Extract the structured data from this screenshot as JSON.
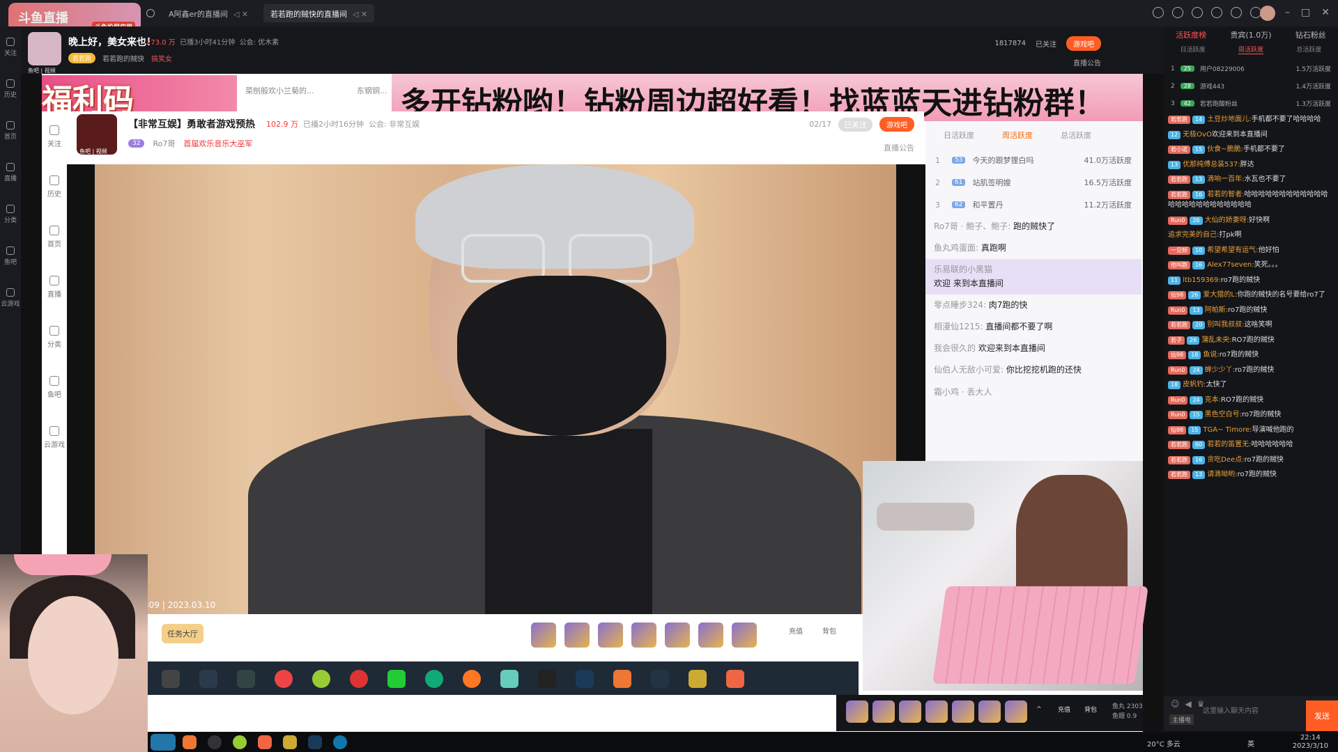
{
  "app": {
    "logo_text": "斗鱼直播",
    "logo_sub": "斗鱼投屏应用",
    "tabs": [
      {
        "label": "A阿鑫er的直播间"
      },
      {
        "label": "若若跑的贼快的直播间"
      }
    ],
    "window_controls": [
      "–",
      "□",
      "✕"
    ]
  },
  "leftnav": {
    "items": [
      "关注",
      "历史",
      "首页",
      "直播",
      "分类",
      "鱼吧",
      "云游戏"
    ]
  },
  "room": {
    "greeting": "晚上好，美女来也！",
    "hot": "273.0 万",
    "live_time": "已播3小时41分钟",
    "notice_label": "公会: 优木素",
    "level_tag": "若若跑",
    "tag1": "若若跑的贼快",
    "tag2": "搞笑女",
    "avatar_caption": "鱼吧 | 视频",
    "room_id": "1817874",
    "follow_status": "已关注",
    "game_button": "游戏吧",
    "notice_button": "直播公告"
  },
  "stream": {
    "banner_left": "福利码171717",
    "banner_right": "多开钻粉哟！钻粉周边超好看！找蓝蓝天进钻粉群！",
    "overlay_title": "菜刨般欢小兰菊的...",
    "overlay_title2": "东钢铜..."
  },
  "inner": {
    "nav": [
      "关注",
      "历史",
      "首页",
      "直播",
      "分类",
      "鱼吧",
      "云游戏"
    ],
    "title": "【非常互娱】勇敢者游戏预热",
    "hot": "102.9 万",
    "live_time": "已播2小时16分钟",
    "guild": "公会: 非常互娱",
    "host": "Ro7哥",
    "tag": "首届欢乐音乐大巫军",
    "avatar_caption": "鱼吧 | 视频",
    "count": "02/17",
    "follow": "已关注",
    "game_btn": "游戏吧",
    "notice": "直播公告",
    "stamp": "309 | 2023.03.10",
    "task_hall": "任务大厅",
    "recharge": "充值",
    "backpack": "背包"
  },
  "rank": {
    "tabs": [
      "日活跃度",
      "周活跃度",
      "总活跃度"
    ],
    "active_tab": 1,
    "rows": [
      {
        "num": "1",
        "badge": "53",
        "name": "今天的跟梦狸白吗",
        "val": "41.0万活跃度"
      },
      {
        "num": "2",
        "badge": "61",
        "name": "站肌签明嫂",
        "val": "16.5万活跃度"
      },
      {
        "num": "3",
        "badge": "62",
        "name": "和平置丹",
        "val": "11.2万活跃度"
      }
    ],
    "messages": [
      {
        "user": "Ro7哥 · 鲍子、鲍子:",
        "text": "跑的贼快了",
        "hl": false
      },
      {
        "user": "鱼丸鸡蛋面:",
        "text": "真跑啊",
        "hl": false
      },
      {
        "user": "欢迎 来到本直播间",
        "text": "乐易联的小黑猫",
        "hl": true
      },
      {
        "user": "零点睡步324:",
        "text": "肉7跑的快",
        "hl": false
      },
      {
        "user": "相漫仙1215:",
        "text": "直播间都不要了啊",
        "hl": false
      },
      {
        "user": "我会很久的",
        "text": "欢迎来到本直播间",
        "hl": false
      },
      {
        "user": "仙伯人无敌小可爱:",
        "text": "你比挖挖机跑的还快",
        "hl": false
      },
      {
        "user": "霜小鸡 · 丢大人",
        "text": "",
        "hl": false
      }
    ]
  },
  "chat": {
    "tabs": [
      "活跃度榜",
      "贵宾(1.0万)",
      "钻石粉丝"
    ],
    "sub_tabs": [
      "日活跃度",
      "周活跃度",
      "总活跃度"
    ],
    "rank": [
      {
        "num": "1",
        "badge": "25",
        "name": "用户08229006",
        "val": "1.5万活跃度"
      },
      {
        "num": "2",
        "badge": "28",
        "name": "游戏443",
        "val": "1.4万活跃度"
      },
      {
        "num": "3",
        "badge": "42",
        "name": "若若跑酸粉丝",
        "val": "1.3万活跃度"
      }
    ],
    "messages": [
      {
        "fan": "若若跑",
        "lv": "14",
        "name": "土豆炒地面儿:",
        "text": "手机都不要了哈哈哈哈"
      },
      {
        "fan": "",
        "lv": "12",
        "name": "无极OvO",
        "text": "欢迎来到本直播间"
      },
      {
        "fan": "若小诺",
        "lv": "15",
        "name": "伙食~脆脆:",
        "text": "手机都不要了"
      },
      {
        "fan": "",
        "lv": "13",
        "name": "优那纯傅总装537:",
        "text": "胖达"
      },
      {
        "fan": "若若跑",
        "lv": "13",
        "name": "滴响一百年:",
        "text": "水瓦也不要了"
      },
      {
        "fan": "若若跑",
        "lv": "16",
        "name": "若若的智者:",
        "text": "哈哈哈哈哈哈哈哈哈哈哈哈哈哈哈哈哈哈哈哈哈哈哈哈"
      },
      {
        "fan": "Run0",
        "lv": "26",
        "name": "大仙的娇妻呀:",
        "text": "好快啊"
      },
      {
        "fan": "",
        "lv": "",
        "name": "追求完美的自己:",
        "text": "打pk啊"
      },
      {
        "fan": "一见倾",
        "lv": "10",
        "name": "希望希望有运气:",
        "text": "他好怕"
      },
      {
        "fan": "他叫跑",
        "lv": "16",
        "name": "Alex77seven:",
        "text": "笑死。。。"
      },
      {
        "fan": "",
        "lv": "11",
        "name": "ltb159369:",
        "text": "ro7跑的贼快"
      },
      {
        "fan": "仙98",
        "lv": "26",
        "name": "爱大猎的L:",
        "text": "你跑的贼快的名号要给ro7了"
      },
      {
        "fan": "Run0",
        "lv": "13",
        "name": "阿帕斯:",
        "text": "ro7跑的贼快"
      },
      {
        "fan": "若若跑",
        "lv": "20",
        "name": "别叫我叔叔:",
        "text": "这啥笑啊"
      },
      {
        "fan": "若子",
        "lv": "26",
        "name": "蒲乱未央:",
        "text": "RO7跑的贼快"
      },
      {
        "fan": "仙98",
        "lv": "18",
        "name": "鱼说:",
        "text": "ro7跑的贼快"
      },
      {
        "fan": "Run0",
        "lv": "24",
        "name": "蝉少少丫:",
        "text": "ro7跑的贼快"
      },
      {
        "fan": "",
        "lv": "18",
        "name": "皮帆钓:",
        "text": "太快了"
      },
      {
        "fan": "Run0",
        "lv": "24",
        "name": "克本:",
        "text": "RO7跑的贼快"
      },
      {
        "fan": "Run0",
        "lv": "15",
        "name": "黑色空白号:",
        "text": "ro7跑的贼快"
      },
      {
        "fan": "仙98",
        "lv": "15",
        "name": "TGA~ Timore:",
        "text": "导演喊他跑的"
      },
      {
        "fan": "若若跑",
        "lv": "60",
        "name": "若若的笛置无:",
        "text": "哈哈哈哈哈哈"
      },
      {
        "fan": "若若跑",
        "lv": "16",
        "name": "贪吃Dee点:",
        "text": "ro7跑的贼快"
      },
      {
        "fan": "若若跑",
        "lv": "13",
        "name": "请滴呦哟:",
        "text": "ro7跑的贼快"
      }
    ],
    "input_placeholder": "这里输入聊天内容",
    "input_label": "主播电",
    "send": "发送",
    "recharge": "充值",
    "backpack": "背包",
    "stat1": "鱼丸 2303",
    "stat2": "鱼翅 0.9"
  },
  "system": {
    "weather": "20°C 多云",
    "time": "22:14",
    "date": "2023/3/10",
    "lang": "英"
  }
}
